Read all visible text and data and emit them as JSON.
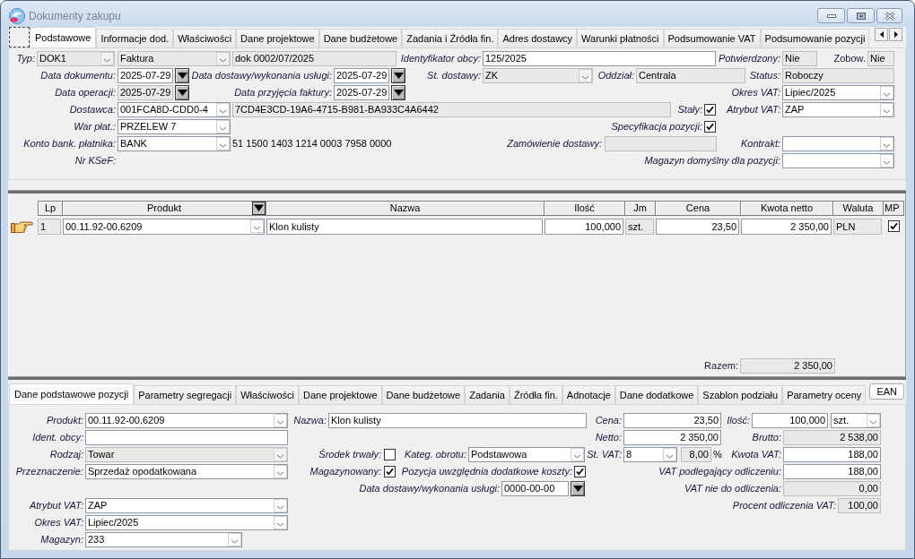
{
  "window": {
    "title": "Dokumenty zakupu"
  },
  "header_tabs": [
    {
      "label": "Podstawowe",
      "selected": true
    },
    {
      "label": "Informacje dod.",
      "selected": false
    },
    {
      "label": "Właściwości",
      "selected": false
    },
    {
      "label": "Dane projektowe",
      "selected": false
    },
    {
      "label": "Dane budżetowe",
      "selected": false
    },
    {
      "label": "Zadania i Źródła fin.",
      "selected": false
    },
    {
      "label": "Adres dostawcy",
      "selected": false
    },
    {
      "label": "Warunki płatności",
      "selected": false
    },
    {
      "label": "Podsumowanie VAT",
      "selected": false
    },
    {
      "label": "Podsumowanie pozycji",
      "selected": false
    }
  ],
  "header_form": {
    "items": [
      {
        "kind": "label",
        "text": "Typ:"
      },
      {
        "kind": "combo",
        "value": "DOK1",
        "disabled": true
      },
      {
        "kind": "combo",
        "value": "Faktura",
        "disabled": true
      },
      {
        "kind": "field",
        "value": "dok 0002/07/2025",
        "disabled": true
      },
      {
        "kind": "label",
        "text": "Identyfikator obcy:"
      },
      {
        "kind": "field",
        "value": "125/2025",
        "disabled": false
      },
      {
        "kind": "label",
        "text": "Potwierdzony:"
      },
      {
        "kind": "field",
        "value": "Nie",
        "disabled": true
      },
      {
        "kind": "label",
        "text": "Zobow."
      },
      {
        "kind": "field",
        "value": "Nie",
        "disabled": true
      },
      {
        "kind": "label",
        "text": "Data dokumentu:"
      },
      {
        "kind": "date",
        "value": "2025-07-29",
        "disabled": false
      },
      {
        "kind": "label",
        "text": "Data dostawy/wykonania usługi:"
      },
      {
        "kind": "date",
        "value": "2025-07-29",
        "disabled": false
      },
      {
        "kind": "label",
        "text": "St. dostawy:"
      },
      {
        "kind": "combo",
        "value": "ZK",
        "disabled": true
      },
      {
        "kind": "label",
        "text": "Oddział:"
      },
      {
        "kind": "field",
        "value": "Centrala",
        "disabled": true
      },
      {
        "kind": "label",
        "text": "Status:"
      },
      {
        "kind": "field",
        "value": "Roboczy",
        "disabled": true
      },
      {
        "kind": "label",
        "text": "Data operacji:"
      },
      {
        "kind": "date",
        "value": "2025-07-29",
        "disabled": true
      },
      {
        "kind": "label",
        "text": "Data przyjęcia faktury:"
      },
      {
        "kind": "date",
        "value": "2025-07-29",
        "disabled": false
      },
      {
        "kind": "label",
        "text": "Okres VAT:"
      },
      {
        "kind": "combo",
        "value": "Lipiec/2025",
        "disabled": false
      },
      {
        "kind": "label",
        "text": "Dostawca:"
      },
      {
        "kind": "combo",
        "value": "001FCA8D-CDD0-4",
        "disabled": false
      },
      {
        "kind": "field",
        "value": "7CD4E3CD-19A6-4715-B981-BA933C4A6442",
        "disabled": true
      },
      {
        "kind": "label",
        "text": "Stały:"
      },
      {
        "kind": "check",
        "checked": true
      },
      {
        "kind": "label",
        "text": "Atrybut VAT:"
      },
      {
        "kind": "combo",
        "value": "ZAP",
        "disabled": false
      },
      {
        "kind": "label",
        "text": "War płat.:"
      },
      {
        "kind": "combo",
        "value": "PRZELEW 7",
        "disabled": false
      },
      {
        "kind": "label",
        "text": "Specyfikacja pozycji:"
      },
      {
        "kind": "check",
        "checked": true
      },
      {
        "kind": "label",
        "text": "Konto bank. płatnika:"
      },
      {
        "kind": "combo",
        "value": "BANK",
        "disabled": false
      },
      {
        "kind": "text",
        "text": "51 1500 1403 1214 0003 7958 0000"
      },
      {
        "kind": "label",
        "text": "Zamówienie dostawy:"
      },
      {
        "kind": "field",
        "disabled": true
      },
      {
        "kind": "label",
        "text": "Kontrakt:"
      },
      {
        "kind": "combo",
        "disabled": false
      },
      {
        "kind": "label",
        "text": "Nr KSeF:"
      },
      {
        "kind": "label",
        "text": "Magazyn domyślny dla pozycji:"
      },
      {
        "kind": "combo",
        "disabled": false
      }
    ]
  },
  "items_table": {
    "columns": [
      "Lp",
      "Produkt",
      "Nazwa",
      "Ilość",
      "Jm",
      "Cena",
      "Kwota netto",
      "Waluta",
      "MP"
    ],
    "rows": [
      {
        "selected": true,
        "checked": true,
        "cells": [
          {
            "value": "1",
            "disabled": true
          },
          {
            "value": "00.11.92-00.6209",
            "disabled": false
          },
          {
            "value": "Klon kulisty",
            "disabled": false
          },
          {
            "value": "100,000",
            "disabled": false
          },
          {
            "value": "szt.",
            "disabled": true
          },
          {
            "value": "23,50",
            "disabled": false
          },
          {
            "value": "2 350,00",
            "disabled": false
          },
          {
            "value": "PLN",
            "disabled": true
          }
        ]
      }
    ],
    "total_label": "Razem:",
    "total": "2 350,00"
  },
  "item_tabs": [
    {
      "label": "Dane podstawowe pozycji",
      "selected": true
    },
    {
      "label": "Parametry segregacji",
      "selected": false
    },
    {
      "label": "Właściwości",
      "selected": false
    },
    {
      "label": "Dane projektowe",
      "selected": false
    },
    {
      "label": "Dane budżetowe",
      "selected": false
    },
    {
      "label": "Zadania",
      "selected": false
    },
    {
      "label": "Źródła fin.",
      "selected": false
    },
    {
      "label": "Adnotacje",
      "selected": false
    },
    {
      "label": "Dane dodatkowe",
      "selected": false
    },
    {
      "label": "Szablon podziału",
      "selected": false
    },
    {
      "label": "Parametry oceny",
      "selected": false
    }
  ],
  "ean_button": {
    "label": "EAN"
  },
  "item_form": {
    "items": [
      {
        "kind": "label",
        "text": "Produkt:"
      },
      {
        "kind": "combo",
        "value": "00.11.92-00.6209",
        "disabled": false
      },
      {
        "kind": "label",
        "text": "Nazwa:"
      },
      {
        "kind": "field",
        "value": "Klon kulisty",
        "disabled": false
      },
      {
        "kind": "label",
        "text": "Cena:"
      },
      {
        "kind": "field",
        "value": "23,50",
        "disabled": false
      },
      {
        "kind": "label",
        "text": "Ilość:"
      },
      {
        "kind": "field",
        "value": "100,000",
        "disabled": false
      },
      {
        "kind": "combo",
        "value": "szt.",
        "disabled": false
      },
      {
        "kind": "label",
        "text": "Ident. obcy:"
      },
      {
        "kind": "field",
        "disabled": false
      },
      {
        "kind": "label",
        "text": "Netto:"
      },
      {
        "kind": "field",
        "value": "2 350,00",
        "disabled": false
      },
      {
        "kind": "label",
        "text": "Brutto:"
      },
      {
        "kind": "field",
        "value": "2 538,00",
        "disabled": true
      },
      {
        "kind": "label",
        "text": "Rodzaj:"
      },
      {
        "kind": "combo",
        "value": "Towar",
        "disabled": true
      },
      {
        "kind": "label",
        "text": "Środek trwały:"
      },
      {
        "kind": "check",
        "checked": false
      },
      {
        "kind": "label",
        "text": "Kateg. obrotu:"
      },
      {
        "kind": "combo",
        "value": "Podstawowa",
        "disabled": false
      },
      {
        "kind": "label",
        "text": "St. VAT:"
      },
      {
        "kind": "combo",
        "value": "8",
        "disabled": false
      },
      {
        "kind": "field",
        "value": "8,00",
        "disabled": true
      },
      {
        "kind": "text",
        "text": "%"
      },
      {
        "kind": "label",
        "text": "Kwota VAT:"
      },
      {
        "kind": "field",
        "value": "188,00",
        "disabled": false
      },
      {
        "kind": "label",
        "text": "Przeznaczenie:"
      },
      {
        "kind": "combo",
        "value": "Sprzedaż opodatkowana",
        "disabled": false
      },
      {
        "kind": "label",
        "text": "Magazynowany:"
      },
      {
        "kind": "check",
        "checked": true
      },
      {
        "kind": "label",
        "text": "Pozycja uwzględnia dodatkowe koszty:"
      },
      {
        "kind": "check",
        "checked": true
      },
      {
        "kind": "label",
        "text": "VAT podlegający odliczeniu:"
      },
      {
        "kind": "field",
        "value": "188,00",
        "disabled": false
      },
      {
        "kind": "label",
        "text": "Data dostawy/wykonania usługi:"
      },
      {
        "kind": "date",
        "value": "0000-00-00",
        "disabled": false
      },
      {
        "kind": "label",
        "text": "VAT nie do odliczenia:"
      },
      {
        "kind": "field",
        "value": "0,00",
        "disabled": true
      },
      {
        "kind": "label",
        "text": "Atrybut VAT:"
      },
      {
        "kind": "combo",
        "value": "ZAP",
        "disabled": false
      },
      {
        "kind": "label",
        "text": "Procent odliczenia VAT:"
      },
      {
        "kind": "field",
        "value": "100,00",
        "disabled": true
      },
      {
        "kind": "label",
        "text": "Okres VAT:"
      },
      {
        "kind": "combo",
        "value": "Lipiec/2025",
        "disabled": false
      },
      {
        "kind": "label",
        "text": "Magazyn:"
      },
      {
        "kind": "combo",
        "value": "233",
        "disabled": false
      }
    ]
  }
}
